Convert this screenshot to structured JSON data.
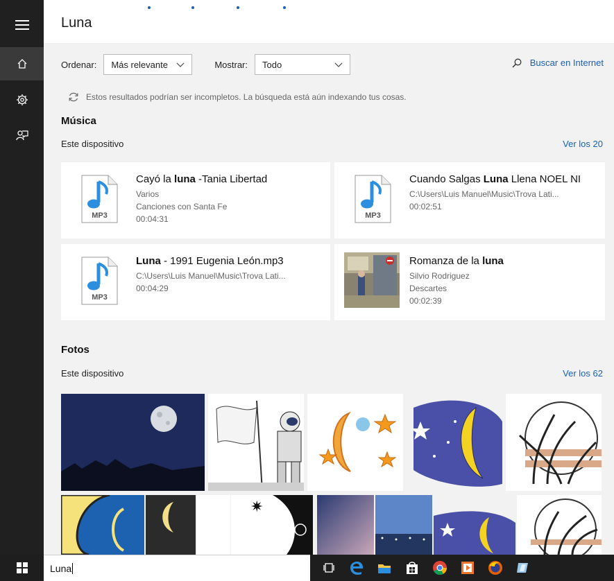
{
  "query": "Luna",
  "filters": {
    "sort_label": "Ordenar:",
    "sort_value": "Más relevante",
    "show_label": "Mostrar:",
    "show_value": "Todo"
  },
  "web_search_label": "Buscar en Internet",
  "notice": "Estos resultados podrían ser incompletos. La búsqueda está aún indexando tus cosas.",
  "music": {
    "title": "Música",
    "subhead": "Este dispositivo",
    "see_all": "Ver los 20",
    "items": [
      {
        "title_pre": "Cayó la ",
        "title_bold": "luna",
        "title_post": " -Tania Libertad",
        "meta": [
          "Varios",
          "Canciones con Santa Fe",
          "00:04:31"
        ],
        "thumb": "mp3-file-icon",
        "thumb_label": "MP3"
      },
      {
        "title_pre": "Cuando Salgas ",
        "title_bold": "Luna",
        "title_post": " Llena NOEL NI",
        "meta": [
          "C:\\Users\\Luis Manuel\\Music\\Trova Lati...",
          "00:02:51"
        ],
        "thumb": "mp3-file-icon",
        "thumb_label": "MP3"
      },
      {
        "title_pre": "",
        "title_bold": "Luna",
        "title_post": " - 1991 Eugenia León.mp3",
        "meta": [
          "C:\\Users\\Luis Manuel\\Music\\Trova Lati...",
          "00:04:29"
        ],
        "thumb": "mp3-file-icon",
        "thumb_label": "MP3"
      },
      {
        "title_pre": "Romanza de la ",
        "title_bold": "luna",
        "title_post": "",
        "meta": [
          "Silvio Rodriguez",
          "Descartes",
          "00:02:39"
        ],
        "thumb": "album-art"
      }
    ]
  },
  "photos": {
    "title": "Fotos",
    "subhead": "Este dispositivo",
    "see_all": "Ver los 62"
  },
  "colors": {
    "accent": "#1a5fb4",
    "rail": "#202020",
    "panel": "#f2f2f2",
    "taskbar": "#1e1e1e"
  }
}
